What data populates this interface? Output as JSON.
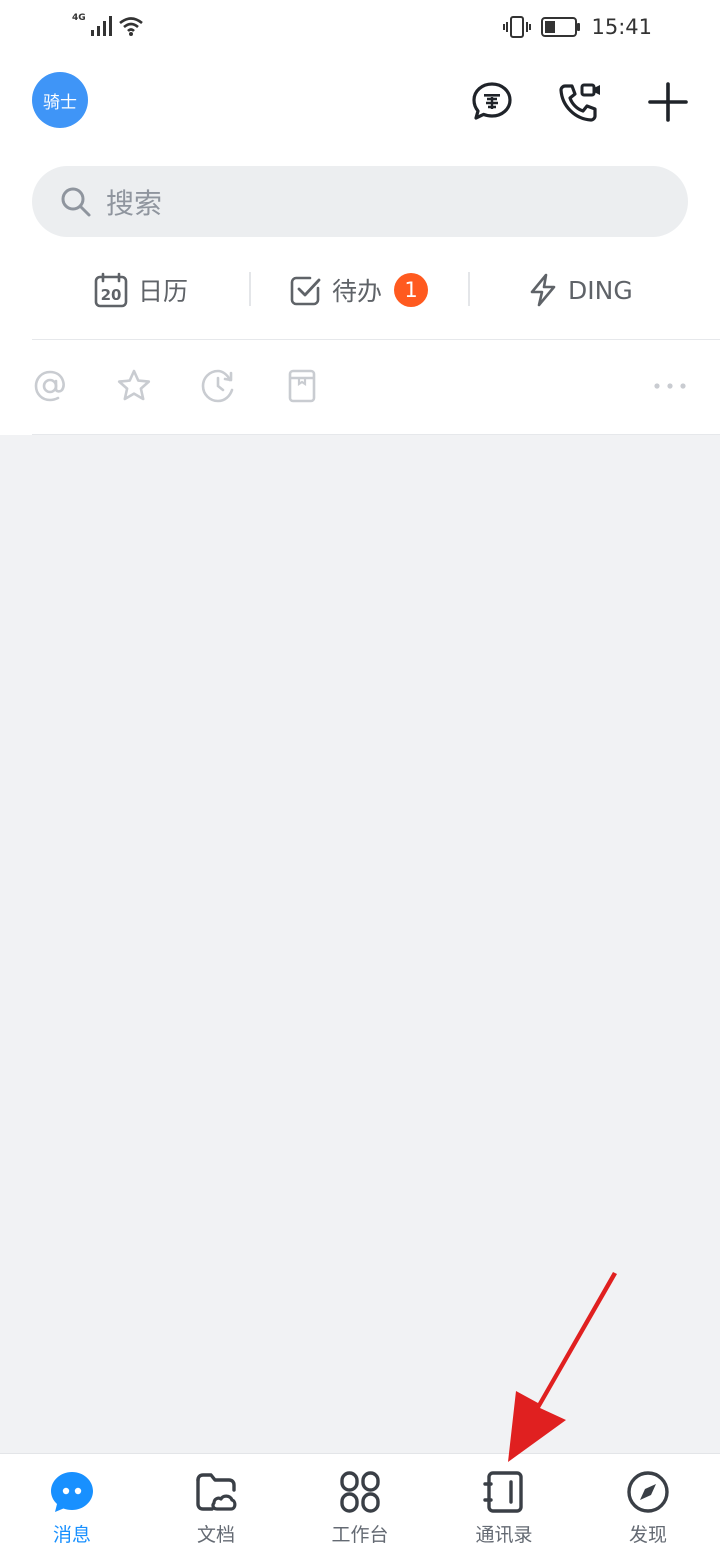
{
  "status_bar": {
    "network": "4G",
    "time": "15:41"
  },
  "header": {
    "avatar_text": "骑士",
    "icons": [
      "secret-chat-icon",
      "video-call-icon",
      "plus-icon"
    ]
  },
  "search": {
    "placeholder": "搜索"
  },
  "quick_actions": [
    {
      "label": "日历",
      "icon": "calendar-icon",
      "icon_text": "20"
    },
    {
      "label": "待办",
      "icon": "checkbox-icon",
      "badge": "1"
    },
    {
      "label": "DING",
      "icon": "lightning-icon"
    }
  ],
  "filters": [
    "at-icon",
    "star-icon",
    "clock-icon",
    "bookmark-icon",
    "more-icon"
  ],
  "tab_bar": {
    "items": [
      {
        "label": "消息",
        "icon": "message-icon",
        "active": true
      },
      {
        "label": "文档",
        "icon": "folder-cloud-icon",
        "active": false
      },
      {
        "label": "工作台",
        "icon": "workbench-icon",
        "active": false
      },
      {
        "label": "通讯录",
        "icon": "contacts-icon",
        "active": false
      },
      {
        "label": "发现",
        "icon": "compass-icon",
        "active": false
      }
    ]
  },
  "colors": {
    "accent": "#1890ff",
    "avatar_bg": "#3f95f7",
    "badge": "#ff5a1f",
    "annotation_arrow": "#e02020"
  }
}
